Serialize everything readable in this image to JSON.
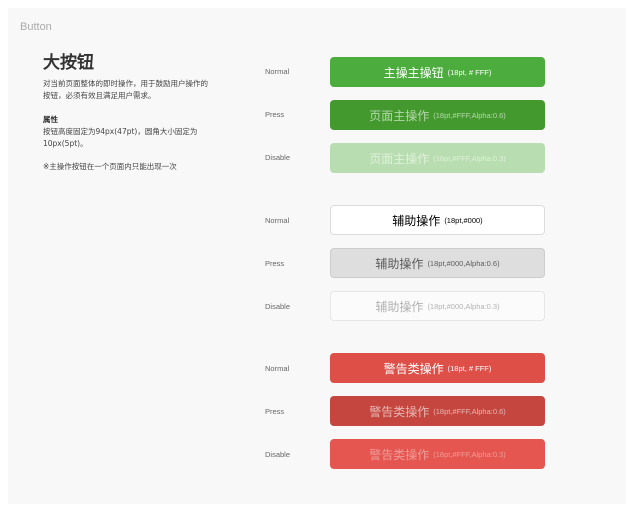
{
  "section_label": "Button",
  "title": "大按钮",
  "description": "对当前页面整体的即时操作，用于鼓励用户操作的按钮，必须有效且满足用户需求。",
  "attributes": {
    "title": "属性",
    "text": "按钮高度固定为94px(47pt)，圆角大小固定为10px(5pt)。"
  },
  "note": "※主操作按钮在一个页面内只能出现一次",
  "states": {
    "normal": "Normal",
    "press": "Press",
    "disable": "Disable"
  },
  "primary": {
    "normal": {
      "label": "主操主操钮",
      "spec": "(18pt, # FFF)"
    },
    "press": {
      "label": "页面主操作",
      "spec": "(18pt,#FFF,Alpha:0.6)"
    },
    "disable": {
      "label": "页面主操作",
      "spec": "(18pt,#FFF,Alpha:0.3)"
    }
  },
  "secondary": {
    "normal": {
      "label": "辅助操作",
      "spec": "(18pt,#000)"
    },
    "press": {
      "label": "辅助操作",
      "spec": "(18pt,#000,Alpha:0.6)"
    },
    "disable": {
      "label": "辅助操作",
      "spec": "(18pt,#000,Alpha:0.3)"
    }
  },
  "warning": {
    "normal": {
      "label": "警告类操作",
      "spec": "(18pt, # FFF)"
    },
    "press": {
      "label": "警告类操作",
      "spec": "(18pt,#FFF,Alpha:0.6)"
    },
    "disable": {
      "label": "警告类操作",
      "spec": "(18pt,#FFF,Alpha:0.3)"
    }
  },
  "colors": {
    "primary": "#4cac3d",
    "secondary": "#ffffff",
    "warning": "#de4f48"
  }
}
